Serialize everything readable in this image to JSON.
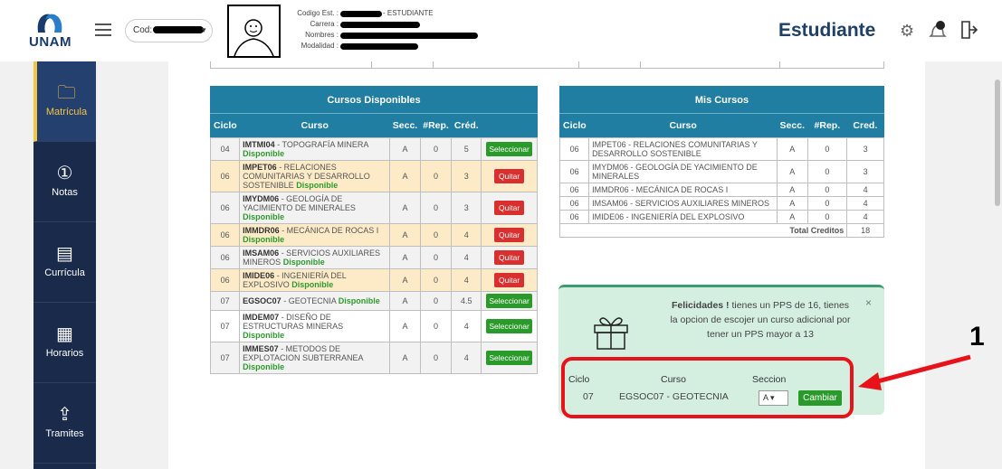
{
  "header": {
    "logo_text": "UNAM",
    "cod_label": "Cod:",
    "info": {
      "codigo_label": "Codigo Est. :",
      "codigo_suffix": "- ESTUDIANTE",
      "carrera_label": "Carrera :",
      "nombres_label": "Nombres :",
      "modalidad_label": "Modalidad :"
    },
    "role": "Estudiante"
  },
  "sidebar": {
    "items": [
      {
        "label": "Matrícula",
        "icon": "folder-icon"
      },
      {
        "label": "Notas",
        "icon": "medal-icon"
      },
      {
        "label": "Currícula",
        "icon": "clipboard-icon"
      },
      {
        "label": "Horarios",
        "icon": "calendar-icon"
      },
      {
        "label": "Tramites",
        "icon": "upload-icon"
      }
    ]
  },
  "cursos_disponibles": {
    "title": "Cursos Disponibles",
    "headers": [
      "Ciclo",
      "Curso",
      "Secc.",
      "#Rep.",
      "Créd."
    ],
    "rows": [
      {
        "ciclo": "04",
        "code": "IMTMI04",
        "name": " - TOPOGRAFÍA MINERA",
        "status": "Disponible",
        "secc": "A",
        "rep": "0",
        "cred": "5",
        "action": "Seleccionar",
        "style": "grey"
      },
      {
        "ciclo": "06",
        "code": "IMPET06",
        "name": " - RELACIONES COMUNITARIAS Y DESARROLLO SOSTENIBLE",
        "status": "Disponible",
        "secc": "A",
        "rep": "0",
        "cred": "3",
        "action": "Quitar",
        "style": "orange"
      },
      {
        "ciclo": "06",
        "code": "IMYDM06",
        "name": " - GEOLOGÍA DE YACIMIENTO DE MINERALES",
        "status": "Disponible",
        "secc": "A",
        "rep": "0",
        "cred": "3",
        "action": "Quitar",
        "style": "grey"
      },
      {
        "ciclo": "06",
        "code": "IMMDR06",
        "name": " - MECÁNICA DE ROCAS I",
        "status": "Disponible",
        "secc": "A",
        "rep": "0",
        "cred": "4",
        "action": "Quitar",
        "style": "orange"
      },
      {
        "ciclo": "06",
        "code": "IMSAM06",
        "name": " - SERVICIOS AUXILIARES MINEROS",
        "status": "Disponible",
        "secc": "A",
        "rep": "0",
        "cred": "4",
        "action": "Quitar",
        "style": "grey"
      },
      {
        "ciclo": "06",
        "code": "IMIDE06",
        "name": " - INGENIERÍA DEL EXPLOSIVO",
        "status": "Disponible",
        "secc": "A",
        "rep": "0",
        "cred": "4",
        "action": "Quitar",
        "style": "orange"
      },
      {
        "ciclo": "07",
        "code": "EGSOC07",
        "name": " - GEOTECNIA",
        "status": "Disponible",
        "secc": "A",
        "rep": "0",
        "cred": "4.5",
        "action": "Seleccionar",
        "style": "grey"
      },
      {
        "ciclo": "07",
        "code": "IMDEM07",
        "name": " - DISEÑO DE ESTRUCTURAS MINERAS",
        "status": "Disponible",
        "secc": "A",
        "rep": "0",
        "cred": "4",
        "action": "Seleccionar",
        "style": "white"
      },
      {
        "ciclo": "07",
        "code": "IMMES07",
        "name": " - METODOS DE EXPLOTACION SUBTERRANEA",
        "status": "Disponible",
        "secc": "A",
        "rep": "0",
        "cred": "4",
        "action": "Seleccionar",
        "style": "grey"
      }
    ]
  },
  "mis_cursos": {
    "title": "Mis Cursos",
    "headers": [
      "Ciclo",
      "Curso",
      "Secc.",
      "#Rep.",
      "Cred."
    ],
    "rows": [
      {
        "ciclo": "06",
        "name": "IMPET06 - RELACIONES COMUNITARIAS Y DESARROLLO SOSTENIBLE",
        "secc": "A",
        "rep": "0",
        "cred": "3"
      },
      {
        "ciclo": "06",
        "name": "IMYDM06 - GEOLOGÍA DE YACIMIENTO DE MINERALES",
        "secc": "A",
        "rep": "0",
        "cred": "3"
      },
      {
        "ciclo": "06",
        "name": "IMMDR06 - MECÁNICA DE ROCAS I",
        "secc": "A",
        "rep": "0",
        "cred": "4"
      },
      {
        "ciclo": "06",
        "name": "IMSAM06 - SERVICIOS AUXILIARES MINEROS",
        "secc": "A",
        "rep": "0",
        "cred": "4"
      },
      {
        "ciclo": "06",
        "name": "IMIDE06 - INGENIERÍA DEL EXPLOSIVO",
        "secc": "A",
        "rep": "0",
        "cred": "4"
      }
    ],
    "total_label": "Total Creditos",
    "total_value": "18"
  },
  "alert": {
    "bold": "Felicidades !",
    "text": " tienes un PPS de 16, tienes la opcion de escojer un curso adicional por tener un PPS mayor a 13",
    "close": "×"
  },
  "change": {
    "ciclo_label": "Ciclo",
    "curso_label": "Curso",
    "seccion_label": "Seccion",
    "ciclo_value": "07",
    "curso_value": "EGSOC07 - GEOTECNIA",
    "seccion_value": "A",
    "button_label": "Cambiar"
  },
  "annotation": {
    "number": "1"
  },
  "colors": {
    "table_header": "#1f7ea1",
    "sidebar": "#1a2a4a",
    "accent": "#f4c542",
    "select_button": "#2a9a2a",
    "quit_button": "#d9302f",
    "annotation_red": "#e8121a"
  }
}
